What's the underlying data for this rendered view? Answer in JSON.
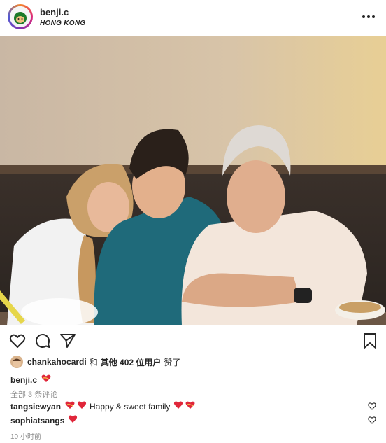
{
  "post": {
    "username": "benji.c",
    "location": "HONG KONG"
  },
  "likes": {
    "liker": "chankahocardi",
    "connector": "和",
    "others": "其他 402 位用户",
    "suffix": "赞了"
  },
  "caption": {
    "username": "benji.c"
  },
  "comments_link": "全部 3 条评论",
  "comments": [
    {
      "username": "tangsiewyan",
      "text": "Happy & sweet family"
    },
    {
      "username": "sophiatsangs",
      "text": ""
    }
  ],
  "timestamp": "10 小时前",
  "icons": {
    "like": "heart-outline-icon",
    "comment": "comment-bubble-icon",
    "share": "paper-plane-icon",
    "save": "bookmark-icon",
    "more": "more-options-icon"
  }
}
